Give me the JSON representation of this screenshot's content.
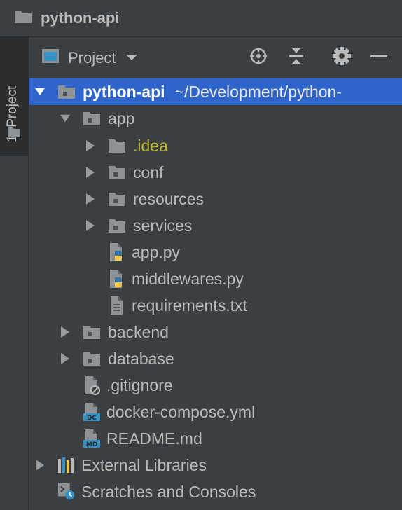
{
  "window": {
    "title": "python-api"
  },
  "tool_strip": {
    "tab_label": "1: Project"
  },
  "panel": {
    "view_label": "Project",
    "actions": [
      "locate-icon",
      "collapse-all-icon",
      "gear-icon",
      "minimize-icon"
    ]
  },
  "tree": {
    "root": {
      "name": "python-api",
      "path": "~/Development/python-",
      "expanded": true
    },
    "app": {
      "name": "app",
      "expanded": true
    },
    "idea": {
      "name": ".idea"
    },
    "conf": {
      "name": "conf"
    },
    "resources": {
      "name": "resources"
    },
    "services": {
      "name": "services"
    },
    "app_py": {
      "name": "app.py"
    },
    "middlewares_py": {
      "name": "middlewares.py"
    },
    "requirements": {
      "name": "requirements.txt"
    },
    "backend": {
      "name": "backend"
    },
    "database": {
      "name": "database"
    },
    "gitignore": {
      "name": ".gitignore"
    },
    "docker_compose": {
      "name": "docker-compose.yml",
      "badge": "DC"
    },
    "readme": {
      "name": "README.md",
      "badge": "MD"
    },
    "external_libraries": {
      "name": "External Libraries"
    },
    "scratches": {
      "name": "Scratches and Consoles"
    }
  },
  "colors": {
    "background": "#3c3f41",
    "selection": "#2f65ca",
    "text": "#bbbbbb",
    "excluded_folder": "#bbb529",
    "file_badge": "#3592c4"
  }
}
